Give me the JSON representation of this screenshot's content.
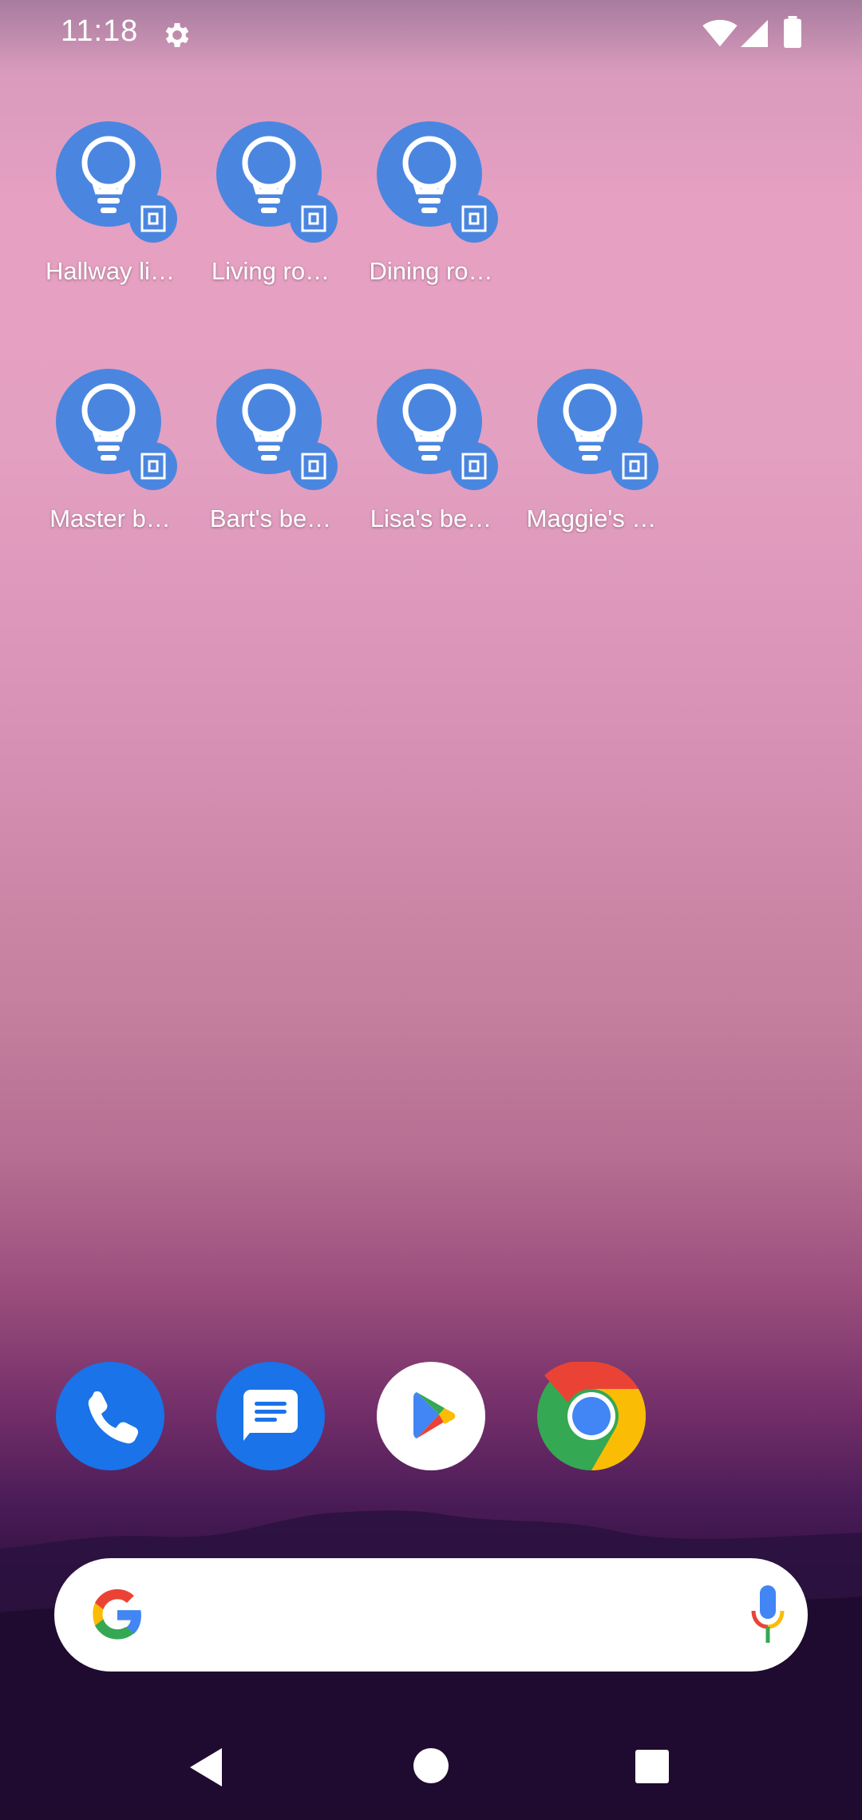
{
  "status_bar": {
    "time": "11:18",
    "icons": [
      "settings-icon",
      "wifi-icon",
      "cell-signal-icon",
      "battery-icon"
    ]
  },
  "apps_row1": [
    {
      "label": "Hallway li…",
      "icon": "light-bulb-shortcut-icon"
    },
    {
      "label": "Living ro…",
      "icon": "light-bulb-shortcut-icon"
    },
    {
      "label": "Dining ro…",
      "icon": "light-bulb-shortcut-icon"
    }
  ],
  "apps_row2": [
    {
      "label": "Master b…",
      "icon": "light-bulb-shortcut-icon"
    },
    {
      "label": "Bart's be…",
      "icon": "light-bulb-shortcut-icon"
    },
    {
      "label": "Lisa's be…",
      "icon": "light-bulb-shortcut-icon"
    },
    {
      "label": "Maggie's …",
      "icon": "light-bulb-shortcut-icon"
    }
  ],
  "dock": [
    {
      "icon": "phone-icon"
    },
    {
      "icon": "messages-icon"
    },
    {
      "icon": "play-store-icon"
    },
    {
      "icon": "chrome-icon"
    }
  ],
  "search_bar": {
    "icons": [
      "google-g-icon",
      "microphone-icon"
    ]
  },
  "colors": {
    "shortcut_blue": "#4a86e0",
    "phone_blue": "#1a73e8",
    "google_blue": "#4285f4",
    "google_red": "#ea4335",
    "google_yellow": "#fbbc05",
    "google_green": "#34a853"
  },
  "nav_bar": {
    "icons": [
      "back-icon",
      "home-icon",
      "recents-icon"
    ]
  }
}
